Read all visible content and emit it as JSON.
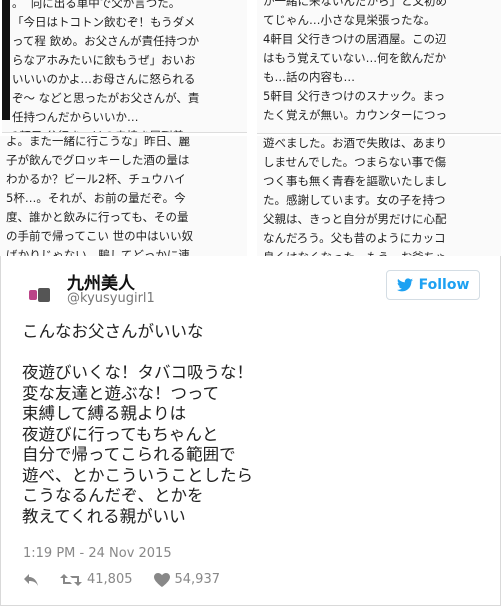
{
  "collage": {
    "panel1": "。  向に出る車中で父か言つた。\n「今日はトコトン飲むぞ！もうダメ\nって程 飲め。お父さんが責任持つか\nらなアホみたいに飲もうぜ」おいお\nいいいのかよ…お母さんに怒られる\nぞ～ などと思ったがお父さんが、責\n任持つんだからいいか…\n1軒目 父行きつけの串焼き屋到着。",
    "panel2": "よ。また一緒に行こうな」昨日、麗\n子が飲んでグロッキーした酒の量は\nわかるか？ビール2杯、チュウハイ\n5杯…。それが、お前の量だぞ。今\n度、誰かと飲みに行っても、その量\nの手前で帰ってこい 世の中はいい奴\nばかりじゃない。騙してどっかに連",
    "panel3": "か一緒に来ないんだから」と父初め\nてじゃん…小さな見栄張ったな。\n4軒目 父行きつけの居酒屋。この辺\nはもう覚えていない…何を飲んだか\nも…話の内容も…\n5軒目 父行きつけのスナック。まっ\nたく覚えが無い。カウンターにつっ",
    "panel4": "遊べました。お酒で失敗は、あまり\nしませんでした。つまらない事で傷\nつく事も無く青春を謳歌いたしまし\nた。感謝しています。女の子を持つ\n父親は、きっと自分が男だけに心配\nなんだろう。父も昔のようにカッコ\n良くはなくなった。もう、お爺ちゃ"
  },
  "tweet": {
    "name": "九州美人",
    "handle": "@kyusyugirl1",
    "follow_label": "Follow",
    "text": "こんなお父さんがいいな\n\n夜遊びいくな！タバコ吸うな！\n変な友達と遊ぶな！つって\n束縛して縛る親よりは\n夜遊びに行ってもちゃんと\n自分で帰ってこられる範囲で\n遊べ、とかこういうことしたら\nこうなるんだぞ、とかを\n教えてくれる親がいい",
    "timestamp": "1:19 PM - 24 Nov 2015",
    "retweets": "41,805",
    "likes": "54,937",
    "colors": {
      "accent": "#1da1f2",
      "muted": "#888888"
    },
    "icons": [
      "reply-icon",
      "retweet-icon",
      "heart-icon",
      "twitter-bird-icon"
    ]
  }
}
